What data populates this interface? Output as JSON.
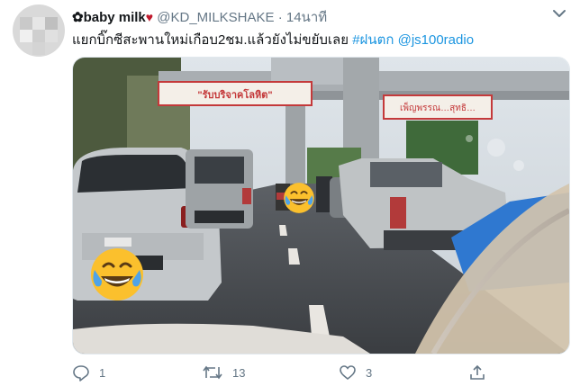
{
  "tweet": {
    "display_name": "✿baby milk",
    "heart": "♥",
    "handle": "@KD_MILKSHAKE",
    "separator": "·",
    "time": "14นาที",
    "text_main": "แยกบิ๊กซีสะพานใหม่เกือบ2ชม.แล้วยังไม่ขยับเลย",
    "hashtag": "#ฝนตก",
    "mention": "@js100radio",
    "media": {
      "banner_left": "\"รับบริจาคโลหิต\"",
      "banner_right": "เพ็ญพรรณ…สุทธิ…"
    },
    "actions": {
      "reply_count": "1",
      "retweet_count": "13",
      "like_count": "3"
    }
  },
  "colors": {
    "link": "#1b95e0",
    "meta": "#657786",
    "text": "#14171a",
    "heart": "#c0192c"
  }
}
